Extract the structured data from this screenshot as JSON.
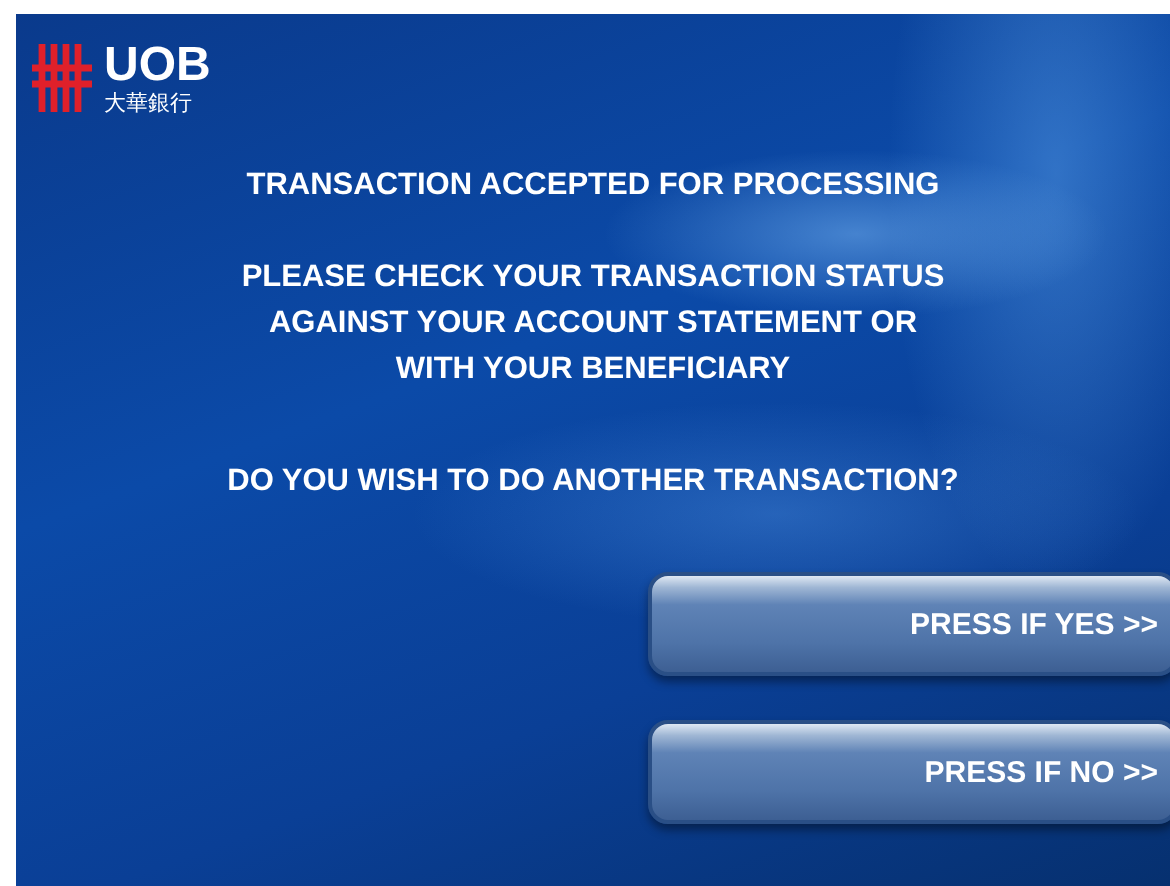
{
  "logo": {
    "name": "UOB",
    "subtitle": "大華銀行"
  },
  "heading": "TRANSACTION ACCEPTED FOR PROCESSING",
  "message_lines": [
    "PLEASE CHECK YOUR TRANSACTION STATUS",
    "AGAINST YOUR ACCOUNT STATEMENT OR",
    "WITH YOUR BENEFICIARY"
  ],
  "question": "DO YOU WISH TO DO ANOTHER TRANSACTION?",
  "buttons": [
    {
      "label": "PRESS IF YES >>"
    },
    {
      "label": "PRESS IF NO >>"
    }
  ]
}
